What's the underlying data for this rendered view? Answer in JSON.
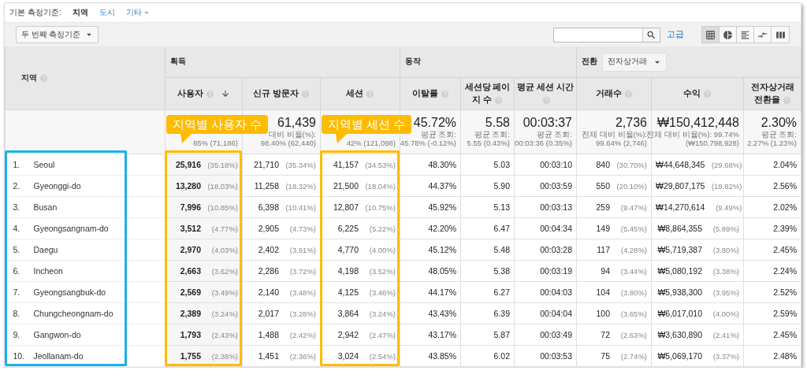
{
  "dimension_bar": {
    "label": "기본 측정기준:",
    "options": [
      {
        "label": "지역",
        "selected": true,
        "kind": "link"
      },
      {
        "label": "도시",
        "selected": false,
        "kind": "link"
      },
      {
        "label": "기타",
        "selected": false,
        "kind": "dropdown"
      }
    ]
  },
  "secondary_dimension": {
    "label": "두 번째 측정기준"
  },
  "advanced_link": "고급",
  "view_buttons": [
    {
      "kind": "table",
      "selected": true
    },
    {
      "kind": "pie",
      "selected": false
    },
    {
      "kind": "bar",
      "selected": false
    },
    {
      "kind": "compare",
      "selected": false
    },
    {
      "kind": "pivot",
      "selected": false
    }
  ],
  "table": {
    "dimension_column": "지역",
    "dimension_highlighted": true,
    "groups": [
      {
        "label": "획득"
      },
      {
        "label": "동작"
      },
      {
        "label": "전환",
        "dropdown": "전자상거래"
      }
    ],
    "columns": [
      {
        "label": "사용자",
        "sorted": true,
        "highlighted": true,
        "callout": "지역별 사용자 수"
      },
      {
        "label": "신규 방문자",
        "sorted": false
      },
      {
        "label": "세션",
        "sorted": false,
        "highlighted": true,
        "callout": "지역별 세션 수"
      },
      {
        "label": "이탈률",
        "sorted": false
      },
      {
        "label": "세션당 페이지 수",
        "sorted": false
      },
      {
        "label": "평균 세션 시간",
        "sorted": false
      },
      {
        "label": "거래수",
        "sorted": false
      },
      {
        "label": "수익",
        "sorted": false
      },
      {
        "label": "전자상거래 전환율",
        "sorted": false
      }
    ],
    "summary": [
      {
        "lines": [
          "85% (71,186)"
        ]
      },
      {
        "value": "61,439",
        "lines": [
          "대비 비율(%):",
          "98.40% (62,440)"
        ]
      },
      {
        "lines": [
          "42% (121,098)"
        ]
      },
      {
        "value": "45.72%",
        "lines": [
          "평균 조회:",
          "45.78% (-0.12%)"
        ]
      },
      {
        "value": "5.58",
        "lines": [
          "평균 조회:",
          "5.55 (0.43%)"
        ]
      },
      {
        "value": "00:03:37",
        "lines": [
          "평균 조회:",
          "00:03:36 (0.35%)"
        ]
      },
      {
        "value": "2,736",
        "lines": [
          "전체 대비 비율(%):",
          "99.64% (2,746)"
        ]
      },
      {
        "value": "₩150,412,448",
        "lines": [
          "전체 대비 비율(%): 99.74%",
          "(₩150,798,928)"
        ]
      },
      {
        "value": "2.30%",
        "lines": [
          "평균 조회:",
          "2.27% (1.23%)"
        ]
      }
    ],
    "rows": [
      {
        "index": "1.",
        "region": "Seoul",
        "cells": [
          {
            "value": "25,916",
            "share": "(35.18%)"
          },
          {
            "value": "21,710",
            "share": "(35.34%)"
          },
          {
            "value": "41,157",
            "share": "(34.53%)"
          },
          {
            "value": "48.30%"
          },
          {
            "value": "5.03"
          },
          {
            "value": "00:03:10"
          },
          {
            "value": "840",
            "share": "(30.70%)"
          },
          {
            "value": "₩44,648,345",
            "share": "(29.68%)"
          },
          {
            "value": "2.04%"
          }
        ]
      },
      {
        "index": "2.",
        "region": "Gyeonggi-do",
        "cells": [
          {
            "value": "13,280",
            "share": "(18.03%)"
          },
          {
            "value": "11,258",
            "share": "(18.32%)"
          },
          {
            "value": "21,500",
            "share": "(18.04%)"
          },
          {
            "value": "44.37%"
          },
          {
            "value": "5.90"
          },
          {
            "value": "00:03:59"
          },
          {
            "value": "550",
            "share": "(20.10%)"
          },
          {
            "value": "₩29,807,175",
            "share": "(19.82%)"
          },
          {
            "value": "2.56%"
          }
        ]
      },
      {
        "index": "3.",
        "region": "Busan",
        "cells": [
          {
            "value": "7,996",
            "share": "(10.85%)"
          },
          {
            "value": "6,398",
            "share": "(10.41%)"
          },
          {
            "value": "12,807",
            "share": "(10.75%)"
          },
          {
            "value": "45.92%"
          },
          {
            "value": "5.13"
          },
          {
            "value": "00:03:13"
          },
          {
            "value": "259",
            "share": "(9.47%)"
          },
          {
            "value": "₩14,270,614",
            "share": "(9.49%)"
          },
          {
            "value": "2.02%"
          }
        ]
      },
      {
        "index": "4.",
        "region": "Gyeongsangnam-do",
        "cells": [
          {
            "value": "3,512",
            "share": "(4.77%)"
          },
          {
            "value": "2,905",
            "share": "(4.73%)"
          },
          {
            "value": "6,225",
            "share": "(5.22%)"
          },
          {
            "value": "42.20%"
          },
          {
            "value": "6.47"
          },
          {
            "value": "00:04:34"
          },
          {
            "value": "149",
            "share": "(5.45%)"
          },
          {
            "value": "₩8,864,355",
            "share": "(5.89%)"
          },
          {
            "value": "2.39%"
          }
        ]
      },
      {
        "index": "5.",
        "region": "Daegu",
        "cells": [
          {
            "value": "2,970",
            "share": "(4.03%)"
          },
          {
            "value": "2,402",
            "share": "(3.91%)"
          },
          {
            "value": "4,770",
            "share": "(4.00%)"
          },
          {
            "value": "45.12%"
          },
          {
            "value": "5.48"
          },
          {
            "value": "00:03:28"
          },
          {
            "value": "117",
            "share": "(4.28%)"
          },
          {
            "value": "₩5,719,387",
            "share": "(3.80%)"
          },
          {
            "value": "2.45%"
          }
        ]
      },
      {
        "index": "6.",
        "region": "Incheon",
        "cells": [
          {
            "value": "2,663",
            "share": "(3.62%)"
          },
          {
            "value": "2,286",
            "share": "(3.72%)"
          },
          {
            "value": "4,198",
            "share": "(3.52%)"
          },
          {
            "value": "48.05%"
          },
          {
            "value": "5.38"
          },
          {
            "value": "00:03:19"
          },
          {
            "value": "94",
            "share": "(3.44%)"
          },
          {
            "value": "₩5,080,192",
            "share": "(3.38%)"
          },
          {
            "value": "2.24%"
          }
        ]
      },
      {
        "index": "7.",
        "region": "Gyeongsangbuk-do",
        "cells": [
          {
            "value": "2,569",
            "share": "(3.49%)"
          },
          {
            "value": "2,140",
            "share": "(3.48%)"
          },
          {
            "value": "4,125",
            "share": "(3.46%)"
          },
          {
            "value": "44.17%"
          },
          {
            "value": "6.27"
          },
          {
            "value": "00:04:03"
          },
          {
            "value": "104",
            "share": "(3.80%)"
          },
          {
            "value": "₩5,938,300",
            "share": "(3.95%)"
          },
          {
            "value": "2.52%"
          }
        ]
      },
      {
        "index": "8.",
        "region": "Chungcheongnam-do",
        "cells": [
          {
            "value": "2,389",
            "share": "(3.24%)"
          },
          {
            "value": "2,017",
            "share": "(3.28%)"
          },
          {
            "value": "3,864",
            "share": "(3.24%)"
          },
          {
            "value": "43.43%"
          },
          {
            "value": "6.39"
          },
          {
            "value": "00:04:04"
          },
          {
            "value": "100",
            "share": "(3.65%)"
          },
          {
            "value": "₩6,017,010",
            "share": "(4.00%)"
          },
          {
            "value": "2.59%"
          }
        ]
      },
      {
        "index": "9.",
        "region": "Gangwon-do",
        "cells": [
          {
            "value": "1,793",
            "share": "(2.43%)"
          },
          {
            "value": "1,488",
            "share": "(2.42%)"
          },
          {
            "value": "2,942",
            "share": "(2.47%)"
          },
          {
            "value": "43.17%"
          },
          {
            "value": "5.87"
          },
          {
            "value": "00:03:49"
          },
          {
            "value": "72",
            "share": "(2.63%)"
          },
          {
            "value": "₩3,630,890",
            "share": "(2.41%)"
          },
          {
            "value": "2.45%"
          }
        ]
      },
      {
        "index": "10.",
        "region": "Jeollanam-do",
        "cells": [
          {
            "value": "1,755",
            "share": "(2.38%)"
          },
          {
            "value": "1,451",
            "share": "(2.36%)"
          },
          {
            "value": "3,024",
            "share": "(2.54%)"
          },
          {
            "value": "43.85%"
          },
          {
            "value": "6.02"
          },
          {
            "value": "00:03:53"
          },
          {
            "value": "75",
            "share": "(2.74%)"
          },
          {
            "value": "₩5,069,170",
            "share": "(3.37%)"
          },
          {
            "value": "2.48%"
          }
        ]
      }
    ]
  }
}
